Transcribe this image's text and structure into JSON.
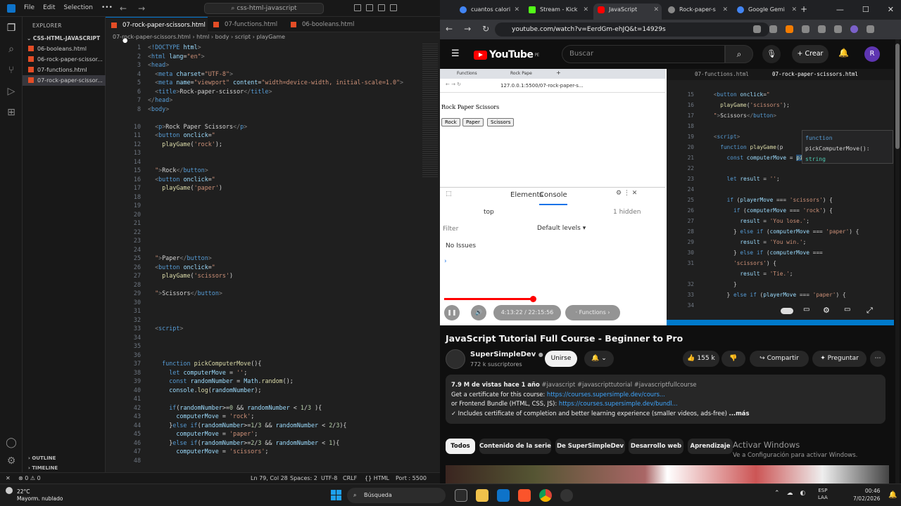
{
  "vscode": {
    "menu": [
      "File",
      "Edit",
      "Selection",
      "•••"
    ],
    "search_text": "css-html-javascript",
    "explorer_title": "EXPLORER",
    "folder": "CSS-HTML-JAVASCRIPT",
    "files": [
      "06-booleans.html",
      "06-rock-paper-scissor...",
      "07-functions.html",
      "07-rock-paper-scissor..."
    ],
    "outline": "OUTLINE",
    "timeline": "TIMELINE",
    "tabs": [
      "07-rock-paper-scissors.html",
      "07-functions.html",
      "06-booleans.html"
    ],
    "breadcrumb": "07-rock-paper-scissors.html  ›  html  ›  body  ›  script  ›  playGame",
    "line_numbers": [
      "1",
      "2",
      "3",
      "4",
      "5",
      "6",
      "7",
      "8",
      "",
      "10",
      "11",
      "12",
      "13",
      "14",
      "15",
      "16",
      "17",
      "18",
      "19",
      "20",
      "21",
      "22",
      "23",
      "24",
      "25",
      "26",
      "27",
      "28",
      "29",
      "30",
      "31",
      "32",
      "33",
      "34",
      "35",
      "36",
      "37",
      "38",
      "39",
      "40",
      "41",
      "42",
      "43",
      "44",
      "45",
      "46",
      "47",
      "48"
    ],
    "status": {
      "errors": "⊗ 0 ⚠ 0",
      "position": "Ln 79, Col 28",
      "spaces": "Spaces: 2",
      "encoding": "UTF-8",
      "eol": "CRLF",
      "lang": "{} HTML",
      "port": "Port : 5500"
    }
  },
  "browser": {
    "tabs": [
      "cuantos calori",
      "Stream - Kick",
      "JavaScript",
      "Rock-paper-s",
      "Google Gemi"
    ],
    "url": "youtube.com/watch?v=EerdGm-ehJQ&t=14929s",
    "yt": {
      "search_placeholder": "Buscar",
      "region": "PE",
      "create": "Crear",
      "avatar": "R",
      "logo": "YouTube"
    },
    "video": {
      "inner_tabs": [
        "Functions",
        "Rock Pape"
      ],
      "inner_url": "127.0.0.1:5500/07-rock-paper-s...",
      "page_heading": "Rock Paper Scissors",
      "buttons": [
        "Rock",
        "Paper",
        "Scissors"
      ],
      "devtools_tabs": [
        "Elements",
        "Console"
      ],
      "top": "top",
      "hidden": "1 hidden",
      "filter": "Filter",
      "levels": "Default levels ▾",
      "no_issues": "No Issues",
      "inner_code_tabs": [
        "07-functions.html",
        "07-rock-paper-scissors.html"
      ],
      "code_line_numbers": [
        "15",
        "16",
        "17",
        "18",
        "19",
        "20",
        "21",
        "22",
        "23",
        "24",
        "25",
        "26",
        "27",
        "28",
        "29",
        "30",
        "31",
        "",
        "32",
        "33",
        "34"
      ],
      "hint_line1": "function",
      "hint_line2": "pickComputerMove():",
      "hint_line3": "string",
      "time": "4:13:22 / 22:15:56",
      "chapter": "Functions",
      "progress": 0.4
    },
    "title": "JavaScript Tutorial Full Course - Beginner to Pro",
    "channel": "SuperSimpleDev",
    "verified": "●",
    "subs": "772 k suscriptores",
    "join": "Unirse",
    "likes": "155 k",
    "share": "Compartir",
    "ask": "Preguntar",
    "desc": {
      "views": "7.9 M de vistas  hace 1 año",
      "tags": "#javascript #javascripttutorial #javascriptfullcourse",
      "line2_a": "Get a certificate for this course: ",
      "line2_b": "https://courses.supersimple.dev/cours...",
      "line3_a": "or Frontend Bundle (HTML, CSS, JS): ",
      "line3_b": "https://courses.supersimple.dev/bundl...",
      "line4": "✓ Includes certificate of completion and better learning experience (smaller videos, ads-free) ",
      "more": "...más"
    },
    "chips": [
      "Todos",
      "Contenido de la serie",
      "De SuperSimpleDev",
      "Desarrollo web",
      "Aprendizaje"
    ],
    "activate1": "Activar Windows",
    "activate2": "Ve a Configuración para activar Windows."
  },
  "taskbar": {
    "temp": "22°C",
    "weather": "Mayorm. nublado",
    "search": "Búsqueda",
    "lang1": "ESP",
    "lang2": "LAA",
    "time": "00:46",
    "date": "7/02/2026"
  }
}
